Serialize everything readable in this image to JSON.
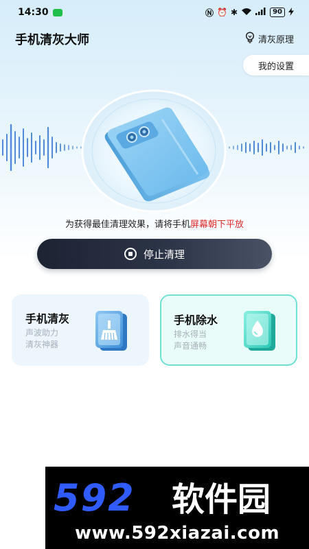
{
  "status_bar": {
    "time": "14:30",
    "battery": "90"
  },
  "header": {
    "title": "手机清灰大师",
    "principle_label": "清灰原理",
    "settings_label": "我的设置"
  },
  "hero": {
    "hint_prefix": "为获得最佳清理效果，请将手机",
    "hint_highlight": "屏幕朝下平放",
    "stop_label": "停止清理"
  },
  "cards": [
    {
      "title": "手机清灰",
      "sub1": "声波助力",
      "sub2": "清灰神器"
    },
    {
      "title": "手机除水",
      "sub1": "排水得当",
      "sub2": "声音通畅"
    }
  ],
  "watermark": {
    "logo_text": "592软件园",
    "url": "www.592xiazai.com"
  },
  "colors": {
    "accent_red": "#e02a2a",
    "button_dark": "#1c2333",
    "card_water_border": "#6fe0d4",
    "banner_blue": "#2f5bff"
  },
  "icons": {
    "principle": "bulb-icon",
    "stop": "stop-circle-icon",
    "ash_card": "broom-icon",
    "water_card": "water-drop-icon"
  }
}
